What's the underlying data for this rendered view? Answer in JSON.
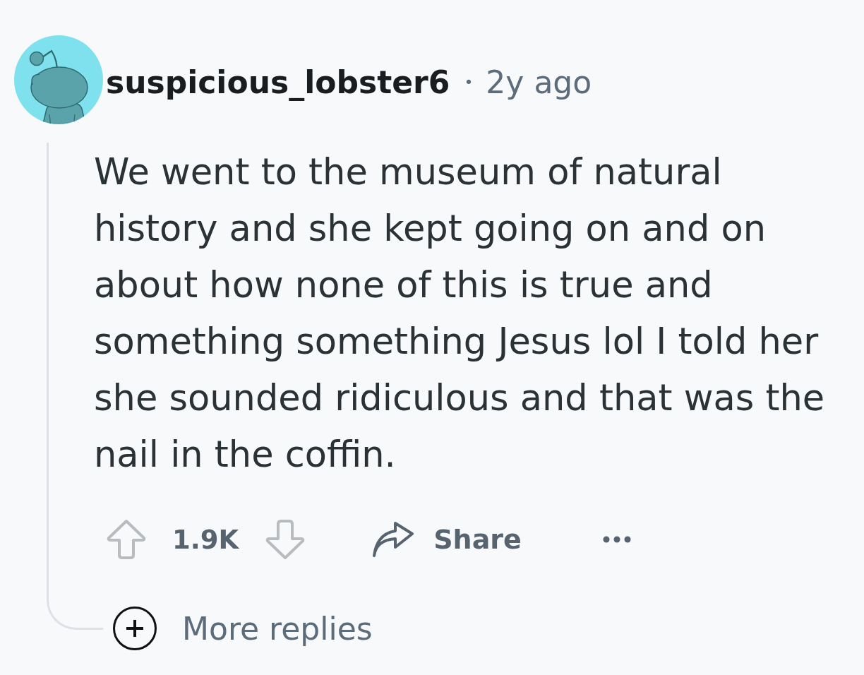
{
  "comment": {
    "author": "suspicious_lobster6",
    "separator": "•",
    "age": "2y ago",
    "body": "We went to the museum of natural history and she kept going on and on about how none of this is true and something something Jesus lol I told her she sounded ridiculous and that was the nail in the coffin.",
    "score": "1.9K",
    "share": "Share",
    "more_replies": "More replies"
  }
}
